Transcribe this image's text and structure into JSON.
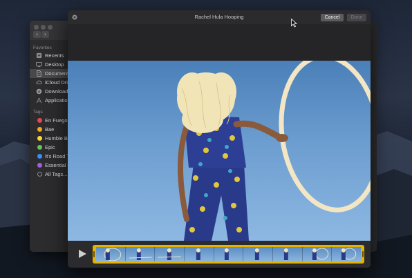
{
  "window": {
    "title": "Rachel Hula Hooping",
    "cancel_label": "Cancel",
    "done_label": "Done"
  },
  "finder": {
    "favorites_header": "Favorites",
    "favorites": [
      {
        "label": "Recents",
        "icon": "clock-icon"
      },
      {
        "label": "Desktop",
        "icon": "desktop-icon"
      },
      {
        "label": "Documents",
        "icon": "document-icon",
        "selected": true
      },
      {
        "label": "iCloud Drive",
        "icon": "cloud-icon"
      },
      {
        "label": "Downloads",
        "icon": "download-icon"
      },
      {
        "label": "Applications",
        "icon": "applications-icon"
      }
    ],
    "tags_header": "Tags",
    "tags": [
      {
        "label": "En Fuego",
        "color": "#e5484d"
      },
      {
        "label": "Bae",
        "color": "#f5a623"
      },
      {
        "label": "Humble Br",
        "color": "#f8d93c"
      },
      {
        "label": "Epic",
        "color": "#62c554"
      },
      {
        "label": "It's Road T",
        "color": "#3a8ef6"
      },
      {
        "label": "Essential C",
        "color": "#a25ddc"
      },
      {
        "label": "All Tags...",
        "color": "#8e8e93"
      }
    ]
  },
  "player": {
    "play_icon": "play-icon",
    "frame_count": 9
  },
  "colors": {
    "filmstrip_border": "#e4b300",
    "window_bg": "#2b2b2d"
  }
}
